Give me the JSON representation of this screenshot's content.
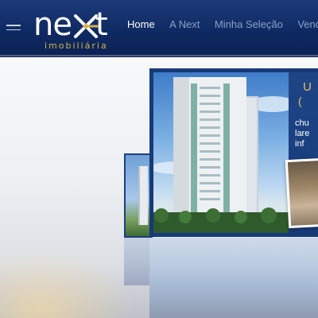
{
  "header": {
    "logo_word": "next",
    "logo_sub": "imobiliária"
  },
  "nav": {
    "items": [
      {
        "label": "Home",
        "active": true
      },
      {
        "label": "A Next",
        "active": false
      },
      {
        "label": "Minha Seleção",
        "active": false
      },
      {
        "label": "Venda seu i",
        "active": false
      }
    ]
  },
  "slide": {
    "panel_title": "U",
    "panel_sub": "(",
    "panel_text": "chu\nlare\ninf"
  },
  "colors": {
    "header_bg": "#0f2a63",
    "accent_gold": "#d5b24a",
    "nav_active": "#ffffff",
    "nav_inactive": "#8aa0c8"
  },
  "icons": {
    "menu": "hamburger-icon",
    "logo_mark": "x-star-icon"
  }
}
